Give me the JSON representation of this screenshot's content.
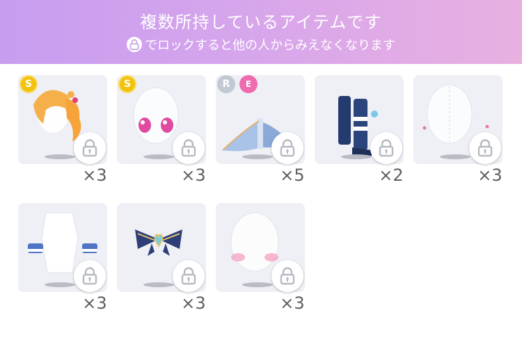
{
  "header": {
    "title": "複数所持しているアイテムです",
    "subtitle": "でロックすると他の人からみえなくなります"
  },
  "items": [
    {
      "icon": "twin-tail-hair-icon",
      "badges": [
        "S"
      ],
      "count": "×3"
    },
    {
      "icon": "pink-eyes-icon",
      "badges": [
        "S"
      ],
      "count": "×3"
    },
    {
      "icon": "wing-skirt-icon",
      "badges": [
        "R",
        "E"
      ],
      "count": "×5"
    },
    {
      "icon": "navy-boots-icon",
      "badges": [],
      "count": "×2"
    },
    {
      "icon": "earrings-icon",
      "badges": [],
      "count": "×3"
    },
    {
      "icon": "wrist-cuffs-icon",
      "badges": [],
      "count": "×3"
    },
    {
      "icon": "heart-ribbon-icon",
      "badges": [],
      "count": "×3"
    },
    {
      "icon": "cheek-blush-icon",
      "badges": [],
      "count": "×3"
    }
  ],
  "colors": {
    "header_start": "#c79df0",
    "header_end": "#e9b0e0",
    "tile_bg": "#eef0f6",
    "count_text": "#5e5e5e",
    "badge_s": "#f2c20c",
    "badge_r": "#c2c9d3",
    "badge_e": "#ee6cae"
  }
}
